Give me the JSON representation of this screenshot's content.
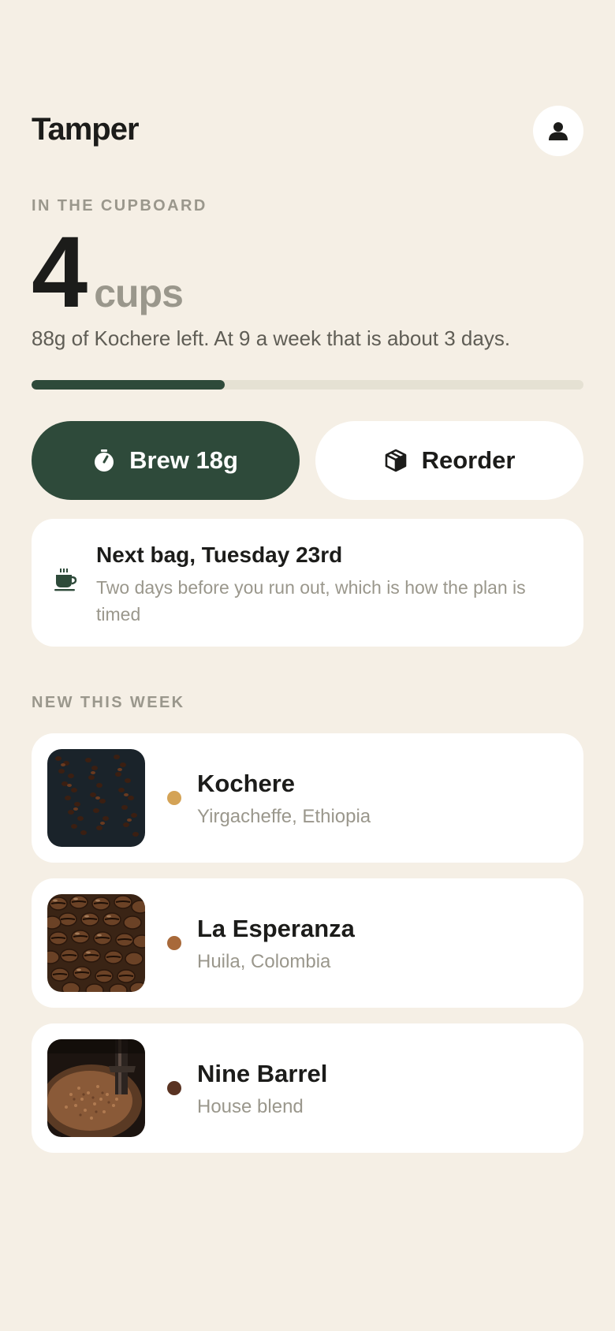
{
  "app": {
    "title": "Tamper",
    "profile_icon": "person-icon"
  },
  "cupboard": {
    "label": "IN THE CUPBOARD",
    "cups_count": "4",
    "cups_unit": "cups",
    "description": "88g of Kochere left. At 9 a week that is about 3 days.",
    "progress_fraction": 0.35,
    "progress_color": "#2e4a3a"
  },
  "actions": {
    "brew_label": "Brew 18g",
    "brew_icon": "timer-icon",
    "reorder_label": "Reorder",
    "reorder_icon": "package-icon"
  },
  "next_bag": {
    "icon": "coffee-cup-icon",
    "title": "Next bag, Tuesday 23rd",
    "subtitle": "Two days before you run out, which is how the plan is timed"
  },
  "new_this_week": {
    "label": "NEW THIS WEEK",
    "items": [
      {
        "name": "Kochere",
        "origin": "Yirgacheffe, Ethiopia",
        "roast_color": "#d4a356"
      },
      {
        "name": "La Esperanza",
        "origin": "Huila, Colombia",
        "roast_color": "#a8693a"
      },
      {
        "name": "Nine Barrel",
        "origin": "House blend",
        "roast_color": "#5a3322"
      }
    ]
  },
  "colors": {
    "background": "#f5efe5",
    "accent": "#2e4a3a",
    "muted": "#9a978c"
  }
}
